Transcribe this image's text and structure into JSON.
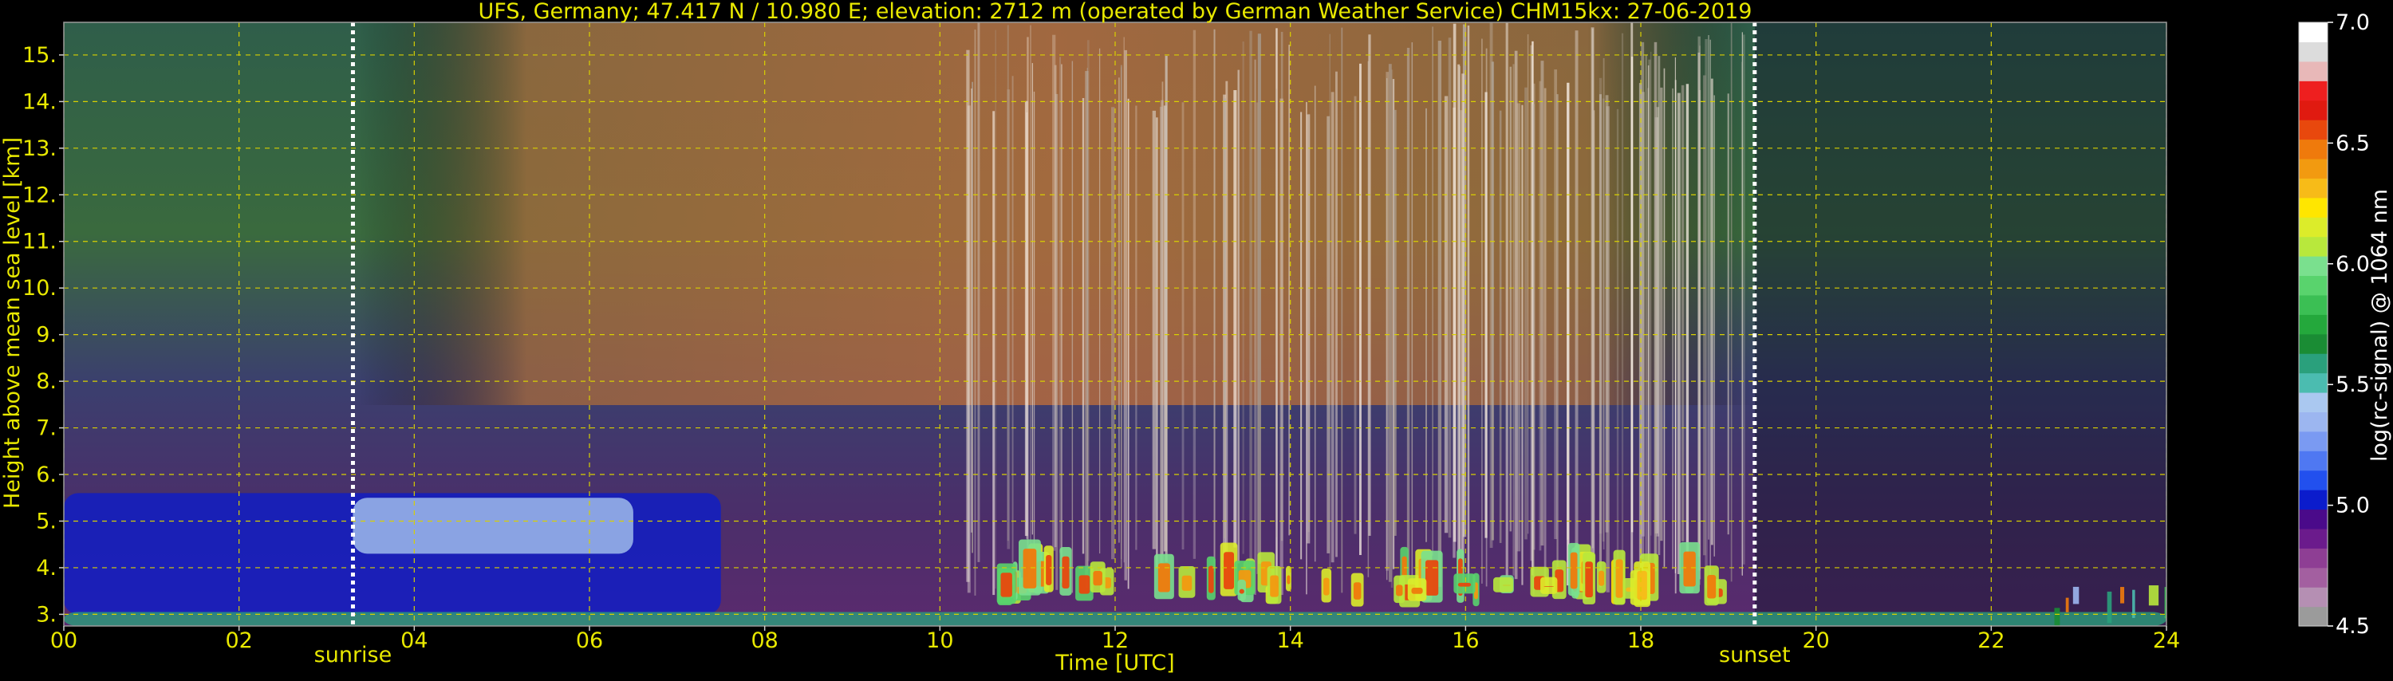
{
  "chart_data": {
    "type": "heatmap",
    "title": "UFS, Germany; 47.417 N / 10.980 E; elevation: 2712 m  (operated by German Weather Service)    CHM15kx: 27-06-2019",
    "xlabel": "Time [UTC]",
    "ylabel": "Height above mean sea level [km]",
    "xlim": [
      0,
      24
    ],
    "ylim": [
      2.75,
      15.7
    ],
    "xticks": [
      0,
      2,
      4,
      6,
      8,
      10,
      12,
      14,
      16,
      18,
      20,
      22,
      24
    ],
    "xtick_labels": [
      "00",
      "02",
      "04",
      "06",
      "08",
      "10",
      "12",
      "14",
      "16",
      "18",
      "20",
      "22",
      "24"
    ],
    "yticks": [
      3,
      4,
      5,
      6,
      7,
      8,
      9,
      10,
      11,
      12,
      13,
      14,
      15
    ],
    "ytick_labels": [
      "3.",
      "4.",
      "5.",
      "6.",
      "7.",
      "8.",
      "9.",
      "10.",
      "11.",
      "12.",
      "13.",
      "14.",
      "15."
    ],
    "grid": true,
    "markers": [
      {
        "name": "sunrise",
        "time": 3.3
      },
      {
        "name": "sunset",
        "time": 19.3
      }
    ],
    "colorbar": {
      "label": "log(rc-signal) @ 1064 nm",
      "range": [
        4.5,
        7.0
      ],
      "ticks": [
        4.5,
        5.0,
        5.5,
        6.0,
        6.5,
        7.0
      ],
      "tick_labels": [
        "4.5",
        "5.0",
        "5.5",
        "6.0",
        "6.5",
        "7.0"
      ],
      "colors": [
        "#9b9b9b",
        "#b58fb3",
        "#a35fa0",
        "#8e3e94",
        "#6b1b8c",
        "#4a0a8a",
        "#0b1ccc",
        "#2250ee",
        "#4f78f2",
        "#7a9af2",
        "#9cb6f0",
        "#aac8f0",
        "#4bbcb0",
        "#2aa07c",
        "#1a8c34",
        "#24a83c",
        "#3bbf54",
        "#59d36d",
        "#7ae08e",
        "#b8e83c",
        "#dcec2a",
        "#ffe600",
        "#f7bb18",
        "#f29a10",
        "#ef7a0c",
        "#e8480d",
        "#e01a10",
        "#ee1f1f",
        "#e8b8b8",
        "#dcdcdc",
        "#ffffff"
      ]
    },
    "features": [
      {
        "name": "residual layer",
        "t_start": 0.0,
        "t_end": 7.5,
        "h_bottom": 3.0,
        "h_top": 5.6,
        "level": 5.05
      },
      {
        "name": "elevated aerosol layer",
        "t_start": 3.3,
        "t_end": 6.5,
        "h_bottom": 4.3,
        "h_top": 5.5,
        "level": 5.4
      },
      {
        "name": "surface layer",
        "t_start": 0.0,
        "t_end": 24.0,
        "h_bottom": 2.75,
        "h_top": 3.05,
        "level": 5.6
      },
      {
        "name": "boundary layer clouds",
        "t_start": 10.5,
        "t_end": 18.9,
        "h_bottom": 3.1,
        "h_top": 4.6,
        "level": 6.45
      },
      {
        "name": "evening cloud",
        "t_start": 22.7,
        "t_end": 24.0,
        "h_bottom": 3.0,
        "h_top": 3.8,
        "level": 6.1
      }
    ]
  }
}
